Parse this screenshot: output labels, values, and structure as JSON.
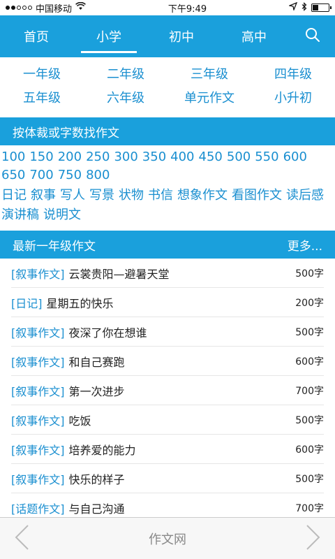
{
  "status_bar": {
    "carrier": "中国移动",
    "time": "下午9:49",
    "signal_dots_filled": 2,
    "battery_level": 0.3
  },
  "nav": {
    "tabs": [
      {
        "label": "首页",
        "active": false
      },
      {
        "label": "小学",
        "active": true
      },
      {
        "label": "初中",
        "active": false
      },
      {
        "label": "高中",
        "active": false
      }
    ],
    "search_icon": "search-icon"
  },
  "grades": [
    "一年级",
    "二年级",
    "三年级",
    "四年级",
    "五年级",
    "六年级",
    "单元作文",
    "小升初"
  ],
  "find_section": {
    "title": "按体裁或字数找作文"
  },
  "word_counts": [
    "100",
    "150",
    "200",
    "250",
    "300",
    "350",
    "400",
    "450",
    "500",
    "550",
    "600",
    "650",
    "700",
    "750",
    "800"
  ],
  "genres": [
    "日记",
    "叙事",
    "写人",
    "写景",
    "状物",
    "书信",
    "想象作文",
    "看图作文",
    "读后感",
    "演讲稿",
    "说明文"
  ],
  "latest_section": {
    "title": "最新一年级作文",
    "more": "更多..."
  },
  "latest_list": [
    {
      "tag": "[叙事作文]",
      "title": "云裳贵阳—避暑天堂",
      "count": "500字"
    },
    {
      "tag": "[日记]",
      "title": "星期五的快乐",
      "count": "200字"
    },
    {
      "tag": "[叙事作文]",
      "title": "夜深了你在想谁",
      "count": "500字"
    },
    {
      "tag": "[叙事作文]",
      "title": "和自己赛跑",
      "count": "600字"
    },
    {
      "tag": "[叙事作文]",
      "title": "第一次进步",
      "count": "700字"
    },
    {
      "tag": "[叙事作文]",
      "title": "吃饭",
      "count": "500字"
    },
    {
      "tag": "[叙事作文]",
      "title": "培养爱的能力",
      "count": "600字"
    },
    {
      "tag": "[叙事作文]",
      "title": "快乐的样子",
      "count": "500字"
    },
    {
      "tag": "[话题作文]",
      "title": "与自己沟通",
      "count": "700字"
    }
  ],
  "bottom_bar": {
    "title": "作文网"
  },
  "colors": {
    "accent": "#1aa0dc",
    "link": "#1a8fd0"
  }
}
